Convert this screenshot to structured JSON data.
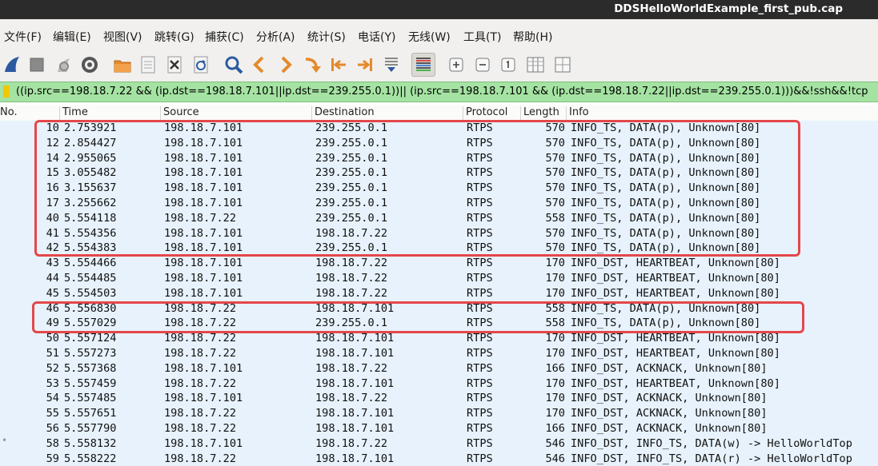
{
  "window": {
    "title": "DDSHelloWorldExample_first_pub.cap"
  },
  "menu": [
    "文件(F)",
    "编辑(E)",
    "视图(V)",
    "跳转(G)",
    "捕获(C)",
    "分析(A)",
    "统计(S)",
    "电话(Y)",
    "无线(W)",
    "工具(T)",
    "帮助(H)"
  ],
  "toolbar_icons": [
    "shark-fin-start-icon",
    "stop-icon",
    "restart-capture-icon",
    "capture-options-icon",
    "open-file-icon",
    "save-file-icon",
    "close-file-icon",
    "reload-file-icon",
    "search-icon",
    "back-arrow-icon",
    "forward-arrow-icon",
    "go-to-packet-icon",
    "first-packet-icon",
    "last-packet-icon",
    "autoscroll-icon",
    "colorize-icon",
    "zoom-in-icon",
    "zoom-out-icon",
    "normal-size-icon",
    "resize-columns-icon",
    "collapse-icon"
  ],
  "filter": {
    "text": "((ip.src==198.18.7.22 && (ip.dst==198.18.7.101||ip.dst==239.255.0.1))|| (ip.src==198.18.7.101 && (ip.dst==198.18.7.22||ip.dst==239.255.0.1)))&&!ssh&&!tcp",
    "bg_color": "#a5e3a3"
  },
  "columns": {
    "no": "No.",
    "time": "Time",
    "source": "Source",
    "destination": "Destination",
    "protocol": "Protocol",
    "length": "Length",
    "info": "Info"
  },
  "packets": [
    {
      "no": "10",
      "time": "2.753921",
      "src": "198.18.7.101",
      "dst": "239.255.0.1",
      "proto": "RTPS",
      "len": "570",
      "info": "INFO_TS, DATA(p), Unknown[80]"
    },
    {
      "no": "12",
      "time": "2.854427",
      "src": "198.18.7.101",
      "dst": "239.255.0.1",
      "proto": "RTPS",
      "len": "570",
      "info": "INFO_TS, DATA(p), Unknown[80]"
    },
    {
      "no": "14",
      "time": "2.955065",
      "src": "198.18.7.101",
      "dst": "239.255.0.1",
      "proto": "RTPS",
      "len": "570",
      "info": "INFO_TS, DATA(p), Unknown[80]"
    },
    {
      "no": "15",
      "time": "3.055482",
      "src": "198.18.7.101",
      "dst": "239.255.0.1",
      "proto": "RTPS",
      "len": "570",
      "info": "INFO_TS, DATA(p), Unknown[80]"
    },
    {
      "no": "16",
      "time": "3.155637",
      "src": "198.18.7.101",
      "dst": "239.255.0.1",
      "proto": "RTPS",
      "len": "570",
      "info": "INFO_TS, DATA(p), Unknown[80]"
    },
    {
      "no": "17",
      "time": "3.255662",
      "src": "198.18.7.101",
      "dst": "239.255.0.1",
      "proto": "RTPS",
      "len": "570",
      "info": "INFO_TS, DATA(p), Unknown[80]"
    },
    {
      "no": "40",
      "time": "5.554118",
      "src": "198.18.7.22",
      "dst": "239.255.0.1",
      "proto": "RTPS",
      "len": "558",
      "info": "INFO_TS, DATA(p), Unknown[80]"
    },
    {
      "no": "41",
      "time": "5.554356",
      "src": "198.18.7.101",
      "dst": "198.18.7.22",
      "proto": "RTPS",
      "len": "570",
      "info": "INFO_TS, DATA(p), Unknown[80]"
    },
    {
      "no": "42",
      "time": "5.554383",
      "src": "198.18.7.101",
      "dst": "239.255.0.1",
      "proto": "RTPS",
      "len": "570",
      "info": "INFO_TS, DATA(p), Unknown[80]"
    },
    {
      "no": "43",
      "time": "5.554466",
      "src": "198.18.7.101",
      "dst": "198.18.7.22",
      "proto": "RTPS",
      "len": "170",
      "info": "INFO_DST, HEARTBEAT, Unknown[80]"
    },
    {
      "no": "44",
      "time": "5.554485",
      "src": "198.18.7.101",
      "dst": "198.18.7.22",
      "proto": "RTPS",
      "len": "170",
      "info": "INFO_DST, HEARTBEAT, Unknown[80]"
    },
    {
      "no": "45",
      "time": "5.554503",
      "src": "198.18.7.101",
      "dst": "198.18.7.22",
      "proto": "RTPS",
      "len": "170",
      "info": "INFO_DST, HEARTBEAT, Unknown[80]"
    },
    {
      "no": "46",
      "time": "5.556830",
      "src": "198.18.7.22",
      "dst": "198.18.7.101",
      "proto": "RTPS",
      "len": "558",
      "info": "INFO_TS, DATA(p), Unknown[80]"
    },
    {
      "no": "49",
      "time": "5.557029",
      "src": "198.18.7.22",
      "dst": "239.255.0.1",
      "proto": "RTPS",
      "len": "558",
      "info": "INFO_TS, DATA(p), Unknown[80]"
    },
    {
      "no": "50",
      "time": "5.557124",
      "src": "198.18.7.22",
      "dst": "198.18.7.101",
      "proto": "RTPS",
      "len": "170",
      "info": "INFO_DST, HEARTBEAT, Unknown[80]"
    },
    {
      "no": "51",
      "time": "5.557273",
      "src": "198.18.7.22",
      "dst": "198.18.7.101",
      "proto": "RTPS",
      "len": "170",
      "info": "INFO_DST, HEARTBEAT, Unknown[80]"
    },
    {
      "no": "52",
      "time": "5.557368",
      "src": "198.18.7.101",
      "dst": "198.18.7.22",
      "proto": "RTPS",
      "len": "166",
      "info": "INFO_DST, ACKNACK, Unknown[80]"
    },
    {
      "no": "53",
      "time": "5.557459",
      "src": "198.18.7.22",
      "dst": "198.18.7.101",
      "proto": "RTPS",
      "len": "170",
      "info": "INFO_DST, HEARTBEAT, Unknown[80]"
    },
    {
      "no": "54",
      "time": "5.557485",
      "src": "198.18.7.101",
      "dst": "198.18.7.22",
      "proto": "RTPS",
      "len": "170",
      "info": "INFO_DST, ACKNACK, Unknown[80]"
    },
    {
      "no": "55",
      "time": "5.557651",
      "src": "198.18.7.22",
      "dst": "198.18.7.101",
      "proto": "RTPS",
      "len": "170",
      "info": "INFO_DST, ACKNACK, Unknown[80]"
    },
    {
      "no": "56",
      "time": "5.557790",
      "src": "198.18.7.22",
      "dst": "198.18.7.101",
      "proto": "RTPS",
      "len": "166",
      "info": "INFO_DST, ACKNACK, Unknown[80]"
    },
    {
      "no": "58",
      "time": "5.558132",
      "src": "198.18.7.101",
      "dst": "198.18.7.22",
      "proto": "RTPS",
      "len": "546",
      "info": "INFO_DST, INFO_TS, DATA(w) -> HelloWorldTop"
    },
    {
      "no": "59",
      "time": "5.558222",
      "src": "198.18.7.22",
      "dst": "198.18.7.101",
      "proto": "RTPS",
      "len": "546",
      "info": "INFO_DST, INFO_TS, DATA(r) -> HelloWorldTop"
    }
  ],
  "row_bg_color": "#e7f2fc",
  "highlight_color": "#e4474a",
  "related_marker": "•"
}
